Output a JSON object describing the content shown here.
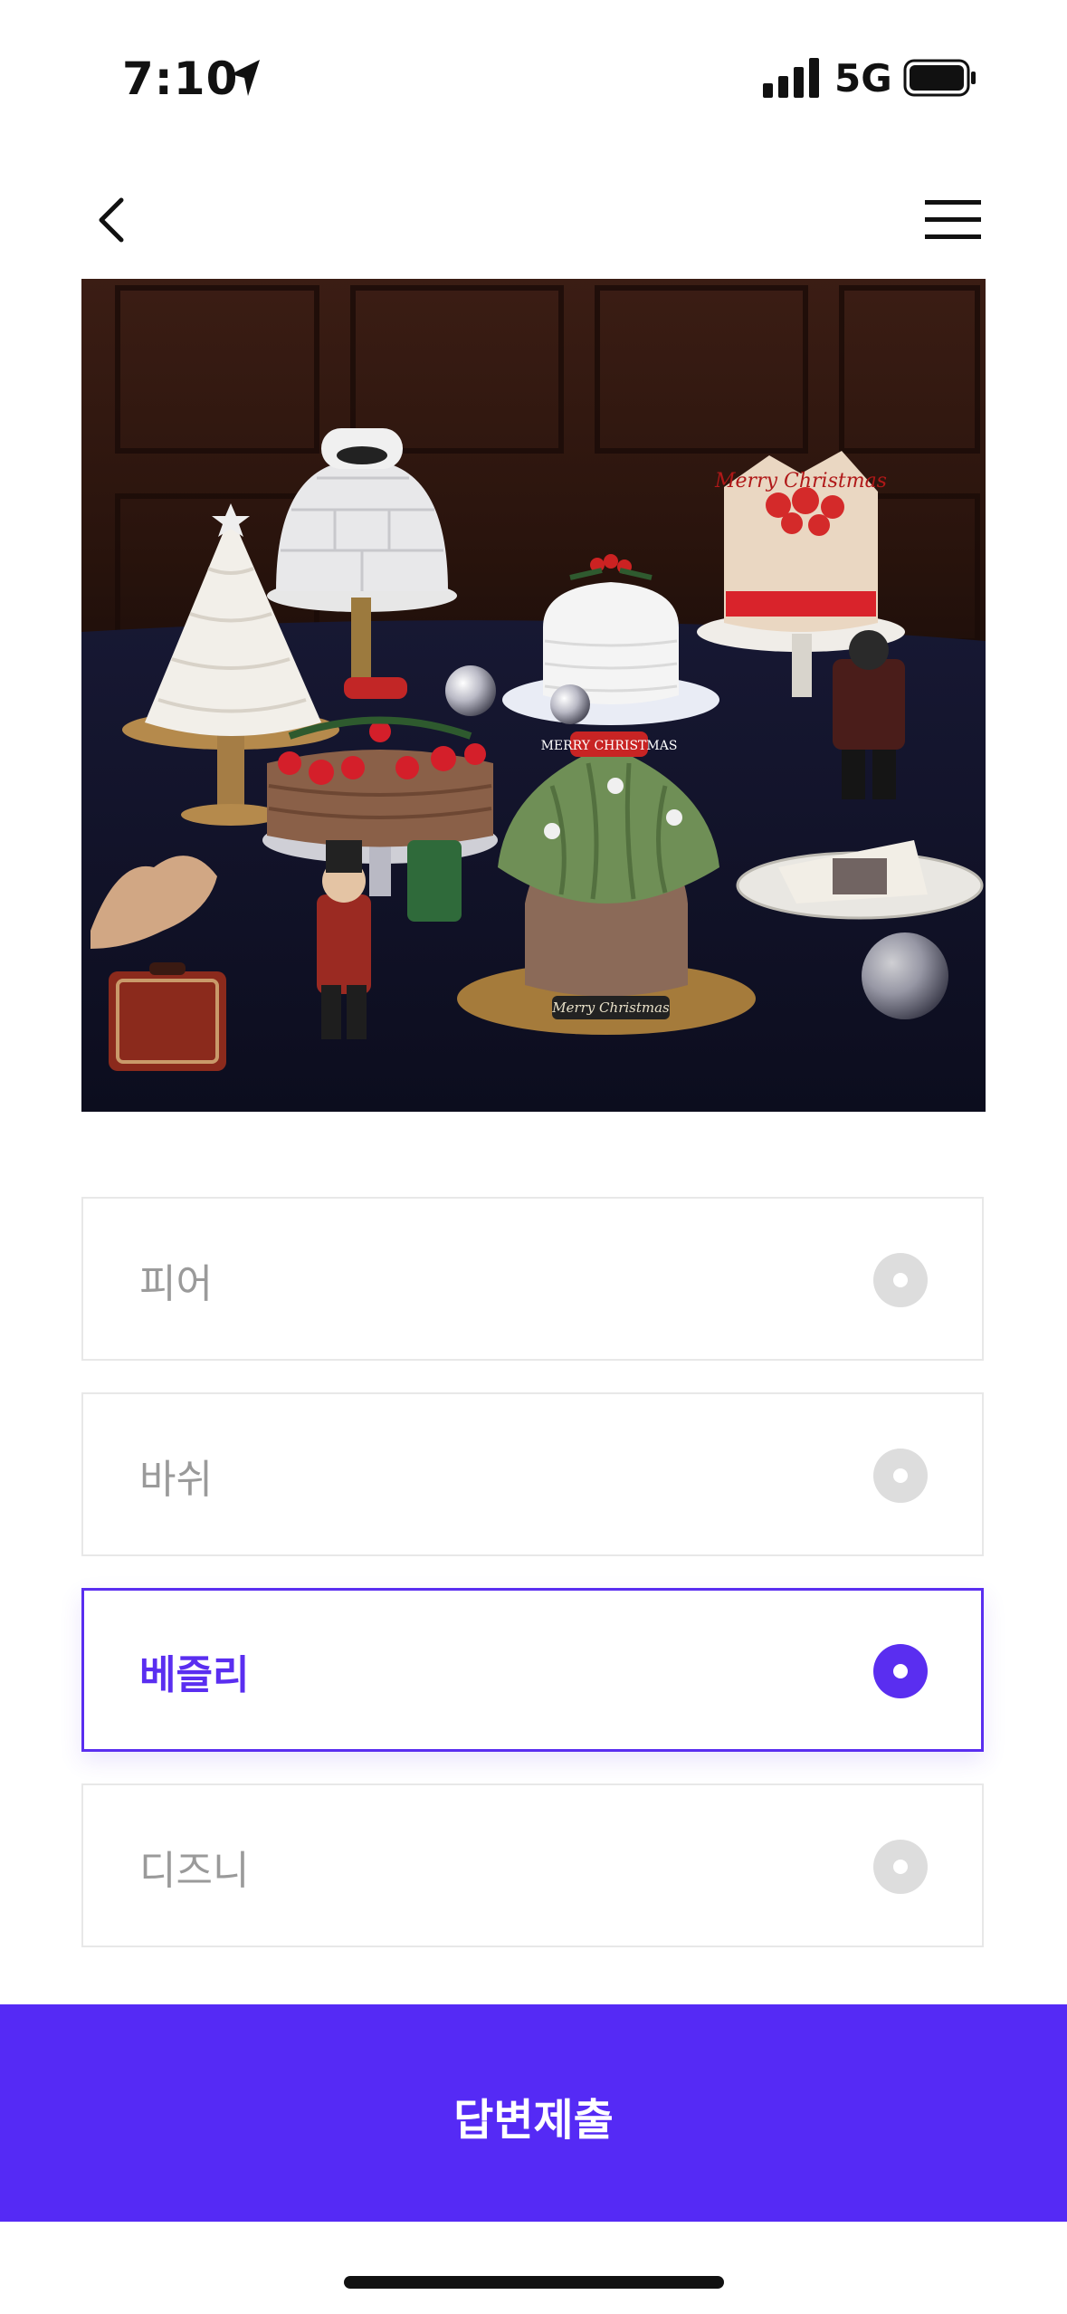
{
  "status_bar": {
    "time": "7:10",
    "network": "5G",
    "location_icon": "location-arrow-icon",
    "signal_icon": "cellular-signal-icon",
    "battery_icon": "battery-full-icon"
  },
  "nav": {
    "back_icon": "chevron-left-icon",
    "menu_icon": "hamburger-menu-icon"
  },
  "hero_image": {
    "description_icon": "christmas-cakes-photo",
    "caption_1": "Merry Christmas",
    "caption_2": "MERRY CHRISTMAS"
  },
  "options": [
    {
      "label": "피어",
      "selected": false
    },
    {
      "label": "바쉬",
      "selected": false
    },
    {
      "label": "베즐리",
      "selected": true
    },
    {
      "label": "디즈니",
      "selected": false
    }
  ],
  "submit": {
    "label": "답변제출"
  },
  "colors": {
    "accent": "#552af5",
    "border": "#e8e8e8",
    "muted": "#9a9a9a"
  }
}
